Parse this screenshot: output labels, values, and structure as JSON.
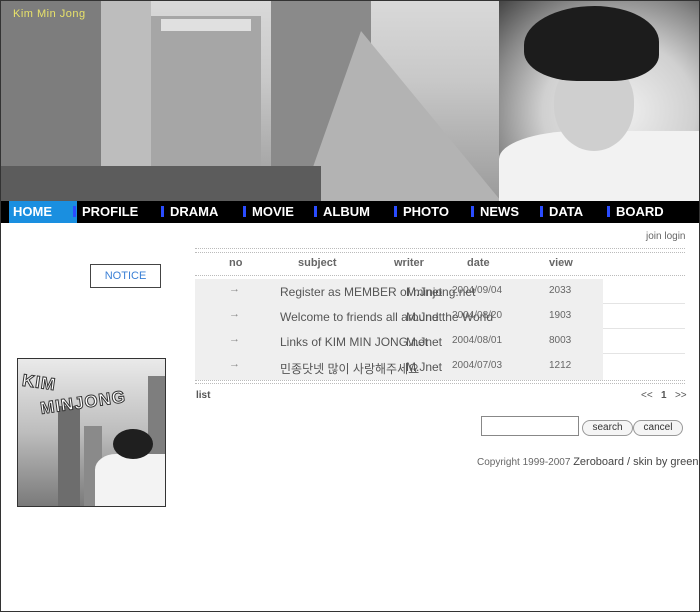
{
  "header": {
    "site_title": "Kim Min Jong"
  },
  "nav": {
    "items": [
      {
        "label": "HOME",
        "active": true
      },
      {
        "label": "PROFILE"
      },
      {
        "label": "DRAMA"
      },
      {
        "label": "MOVIE"
      },
      {
        "label": "ALBUM"
      },
      {
        "label": "PHOTO"
      },
      {
        "label": "NEWS"
      },
      {
        "label": "DATA"
      },
      {
        "label": "BOARD"
      }
    ]
  },
  "sidebar": {
    "notice_label": "NOTICE",
    "thumb_text_line1": "KIM",
    "thumb_text_line2": "MINJONG"
  },
  "top_links": {
    "join": "join",
    "login": "login"
  },
  "board": {
    "columns": {
      "no": "no",
      "subject": "subject",
      "writer": "writer",
      "date": "date",
      "view": "view"
    },
    "rows": [
      {
        "arrow": "→",
        "subject": "Register as MEMBER of minjong.net",
        "writer": "M.Jnet",
        "date": "2004/09/04",
        "view": "2033"
      },
      {
        "arrow": "→",
        "subject": "Welcome to friends all around the World",
        "writer": "M.Jnet",
        "date": "2004/08/20",
        "view": "1903"
      },
      {
        "arrow": "→",
        "subject": "Links of KIM MIN JONG.net",
        "writer": "M.Jnet",
        "date": "2004/08/01",
        "view": "8003"
      },
      {
        "arrow": "→",
        "subject": "민종닷넷 많이 사랑해주세요",
        "writer": "M.Jnet",
        "date": "2004/07/03",
        "view": "1212"
      }
    ],
    "list_label": "list",
    "pager": {
      "prev": "<<",
      "current": "1",
      "next": ">>"
    }
  },
  "search": {
    "value": "",
    "search_label": "search",
    "cancel_label": "cancel"
  },
  "footer": {
    "copyright": "Copyright 1999-2007",
    "credit": "Zeroboard / skin by green"
  }
}
